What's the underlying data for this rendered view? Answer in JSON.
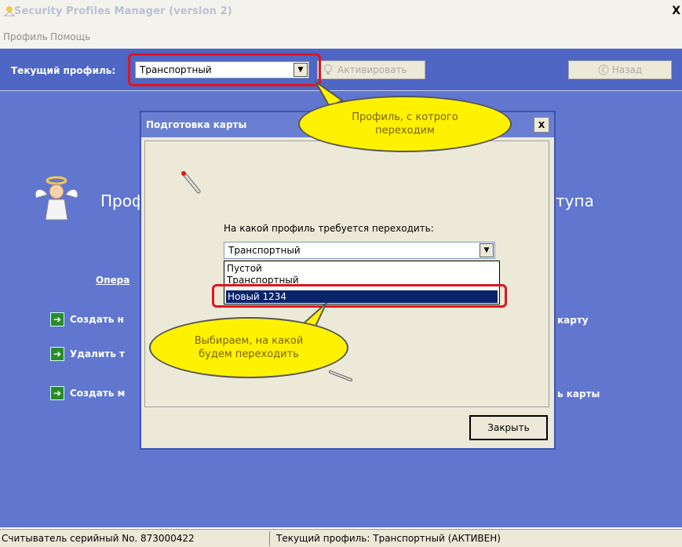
{
  "window": {
    "title": "Security Profiles Manager (version 2)",
    "close_glyph": "X"
  },
  "menu": [
    "Профиль",
    "Помощь"
  ],
  "toolbar": {
    "current_profile_label": "Текущий профиль:",
    "current_profile_value": "Транспортный",
    "activate_label": "Активировать",
    "back_label": "Назад"
  },
  "main": {
    "profile_title_left": "Проф",
    "profile_title_right": "тупа",
    "operations_link": "Опера",
    "actions": [
      "Создать н",
      "Удалить т",
      "Создать м"
    ],
    "right_texts": [
      "карту",
      "ь карты"
    ]
  },
  "dialog": {
    "title": "Подготовка карты",
    "close_glyph": "X",
    "question": "На какой профиль требуется переходить:",
    "select_value": "Транспортный",
    "options": [
      "Пустой",
      "Транспортный",
      "Новый 1234"
    ],
    "selected_option": "Новый 1234",
    "close_button": "Закрыть"
  },
  "callouts": {
    "top": "Профиль, с котрого переходим",
    "bottom": "Выбираем, на какой будем переходить"
  },
  "statusbar": {
    "reader": "Считыватель серийный No. 873000422",
    "profile_status": "Текущий профиль:  Транспортный  (АКТИВЕН)"
  },
  "colors": {
    "background": "#6076cf",
    "callout": "#fff200",
    "highlight": "#e0141e",
    "selection": "#0a246a"
  }
}
